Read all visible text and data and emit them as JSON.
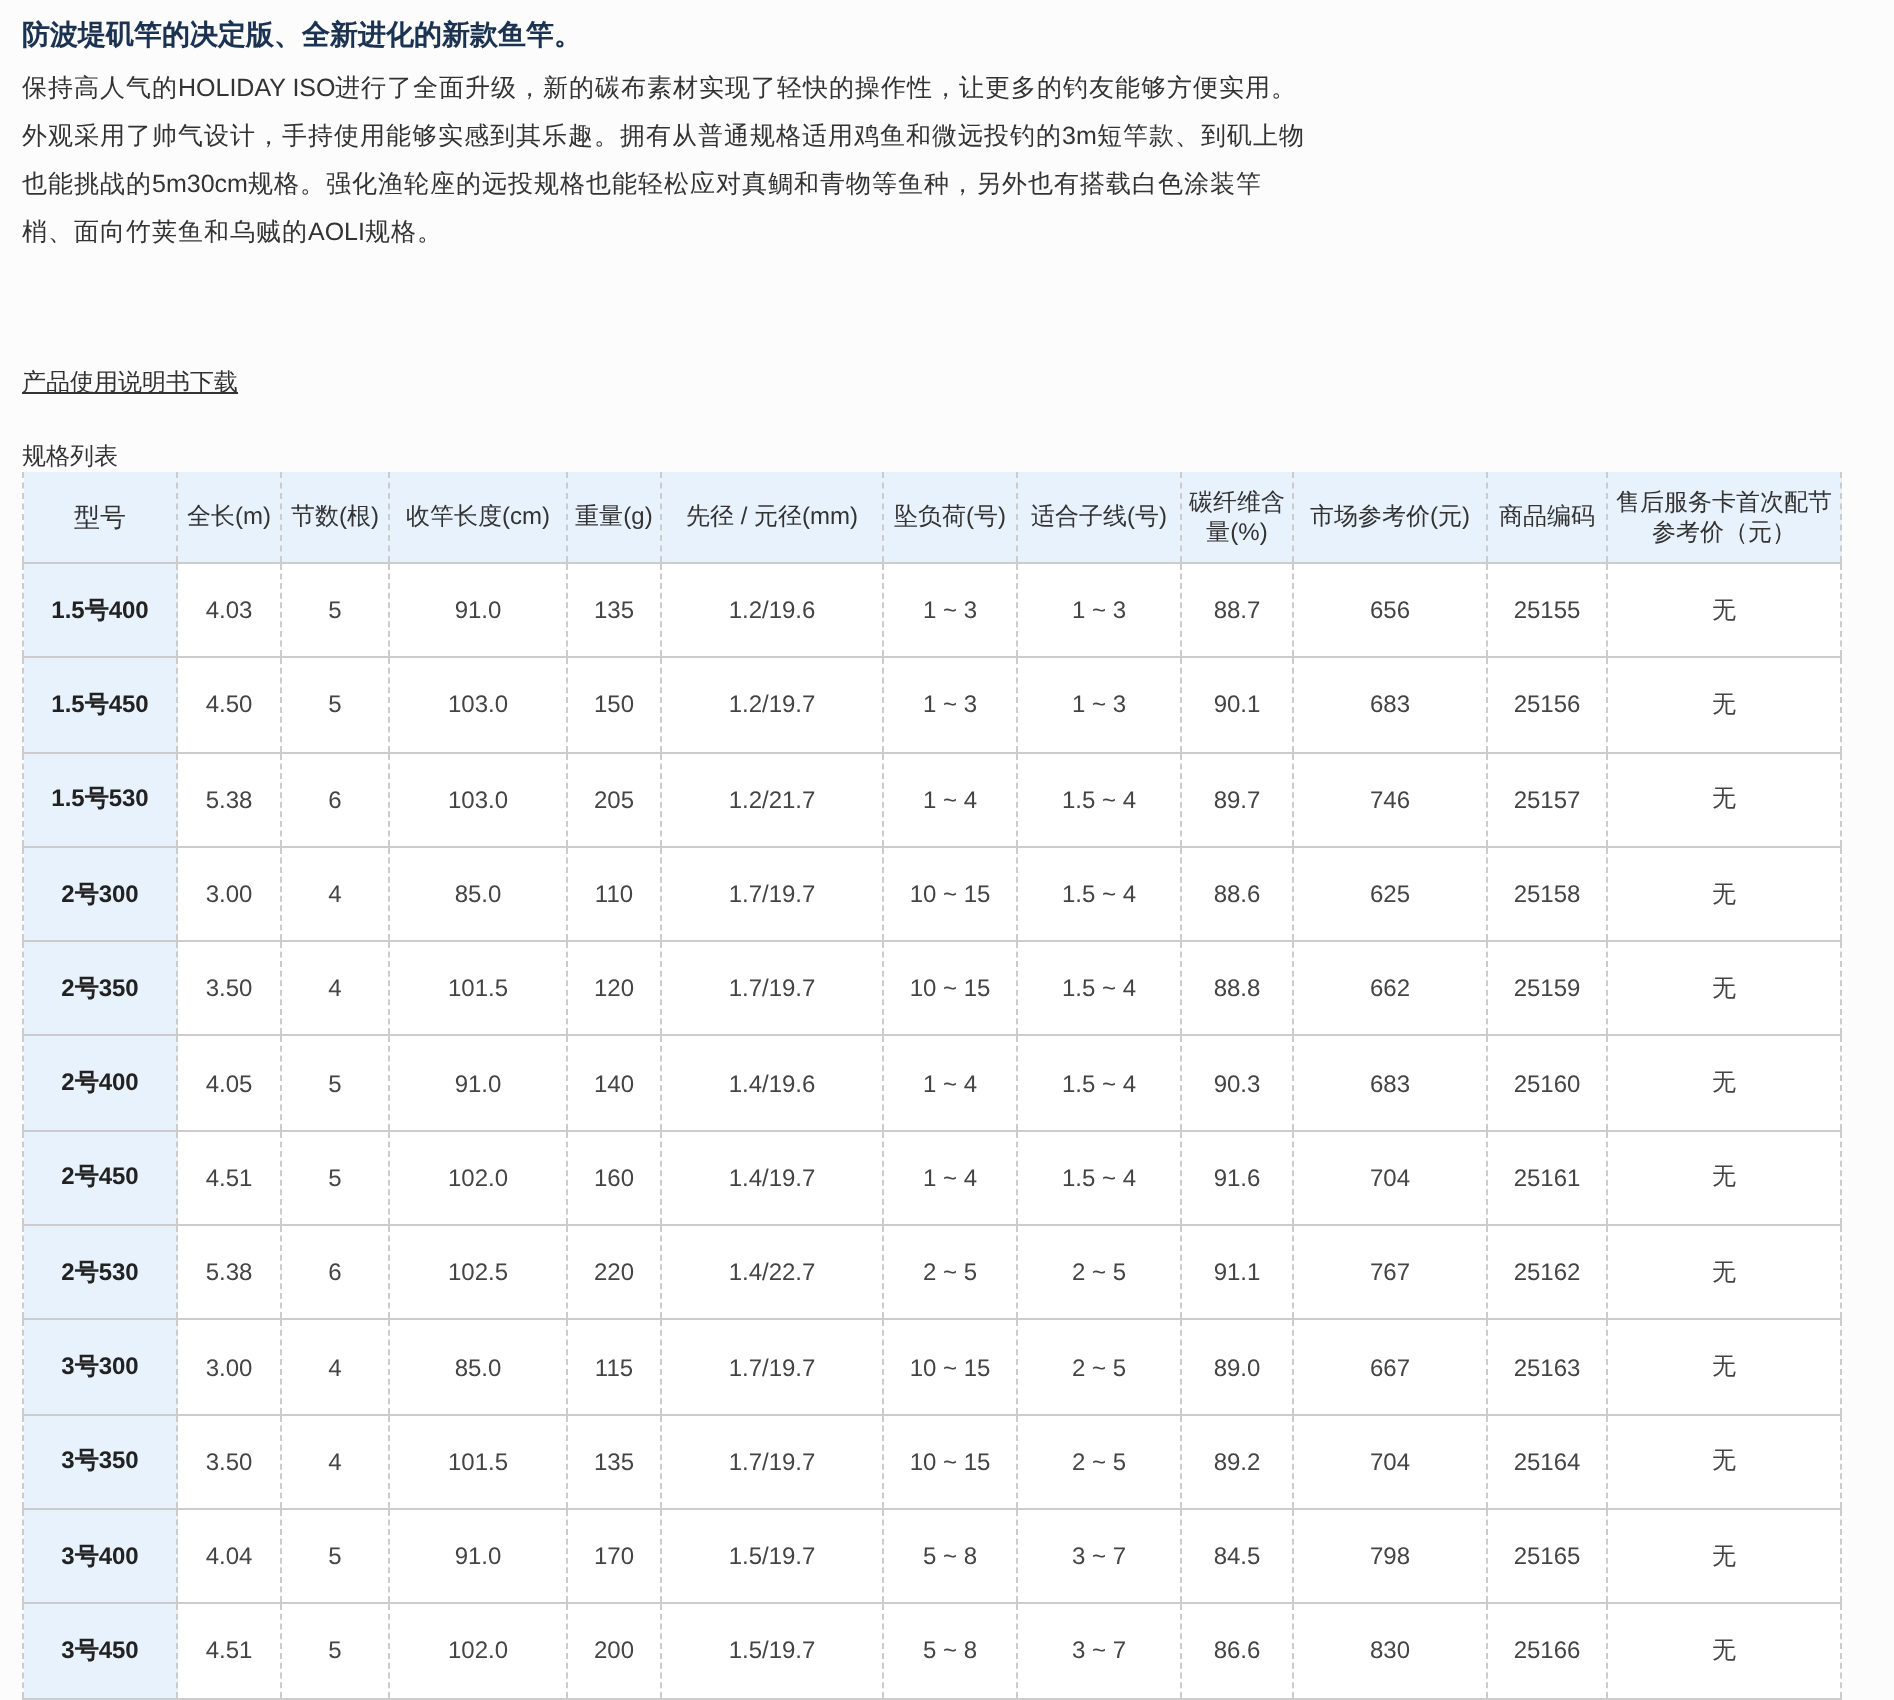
{
  "title": "防波堤矶竿的决定版、全新进化的新款鱼竿。",
  "description": "保持高人气的HOLIDAY ISO进行了全面升级，新的碳布素材实现了轻快的操作性，让更多的钓友能够方便实用。外观采用了帅气设计，手持使用能够实感到其乐趣。拥有从普通规格适用鸡鱼和微远投钓的3m短竿款、到矶上物也能挑战的5m30cm规格。强化渔轮座的远投规格也能轻松应对真鲷和青物等鱼种，另外也有搭载白色涂装竿梢、面向竹荚鱼和乌贼的AOLI规格。",
  "manual_link": "产品使用说明书下载",
  "table": {
    "caption": "规格列表",
    "columns": [
      "型号",
      "全长(m)",
      "节数(根)",
      "收竿长度(cm)",
      "重量(g)",
      "先径 / 元径(mm)",
      "坠负荷(号)",
      "适合子线(号)",
      "碳纤维含量(%)",
      "市场参考价(元)",
      "商品编码",
      "售后服务卡首次配节参考价（元）"
    ],
    "rows": [
      [
        "1.5号400",
        "4.03",
        "5",
        "91.0",
        "135",
        "1.2/19.6",
        "1 ~ 3",
        "1 ~ 3",
        "88.7",
        "656",
        "25155",
        "无"
      ],
      [
        "1.5号450",
        "4.50",
        "5",
        "103.0",
        "150",
        "1.2/19.7",
        "1 ~ 3",
        "1 ~ 3",
        "90.1",
        "683",
        "25156",
        "无"
      ],
      [
        "1.5号530",
        "5.38",
        "6",
        "103.0",
        "205",
        "1.2/21.7",
        "1 ~ 4",
        "1.5 ~ 4",
        "89.7",
        "746",
        "25157",
        "无"
      ],
      [
        "2号300",
        "3.00",
        "4",
        "85.0",
        "110",
        "1.7/19.7",
        "10 ~ 15",
        "1.5 ~ 4",
        "88.6",
        "625",
        "25158",
        "无"
      ],
      [
        "2号350",
        "3.50",
        "4",
        "101.5",
        "120",
        "1.7/19.7",
        "10 ~ 15",
        "1.5 ~ 4",
        "88.8",
        "662",
        "25159",
        "无"
      ],
      [
        "2号400",
        "4.05",
        "5",
        "91.0",
        "140",
        "1.4/19.6",
        "1 ~ 4",
        "1.5 ~ 4",
        "90.3",
        "683",
        "25160",
        "无"
      ],
      [
        "2号450",
        "4.51",
        "5",
        "102.0",
        "160",
        "1.4/19.7",
        "1 ~ 4",
        "1.5 ~ 4",
        "91.6",
        "704",
        "25161",
        "无"
      ],
      [
        "2号530",
        "5.38",
        "6",
        "102.5",
        "220",
        "1.4/22.7",
        "2 ~ 5",
        "2 ~ 5",
        "91.1",
        "767",
        "25162",
        "无"
      ],
      [
        "3号300",
        "3.00",
        "4",
        "85.0",
        "115",
        "1.7/19.7",
        "10 ~ 15",
        "2 ~ 5",
        "89.0",
        "667",
        "25163",
        "无"
      ],
      [
        "3号350",
        "3.50",
        "4",
        "101.5",
        "135",
        "1.7/19.7",
        "10 ~ 15",
        "2 ~ 5",
        "89.2",
        "704",
        "25164",
        "无"
      ],
      [
        "3号400",
        "4.04",
        "5",
        "91.0",
        "170",
        "1.5/19.7",
        "5 ~ 8",
        "3 ~ 7",
        "84.5",
        "798",
        "25165",
        "无"
      ],
      [
        "3号450",
        "4.51",
        "5",
        "102.0",
        "200",
        "1.5/19.7",
        "5 ~ 8",
        "3 ~ 7",
        "86.6",
        "830",
        "25166",
        "无"
      ]
    ]
  }
}
